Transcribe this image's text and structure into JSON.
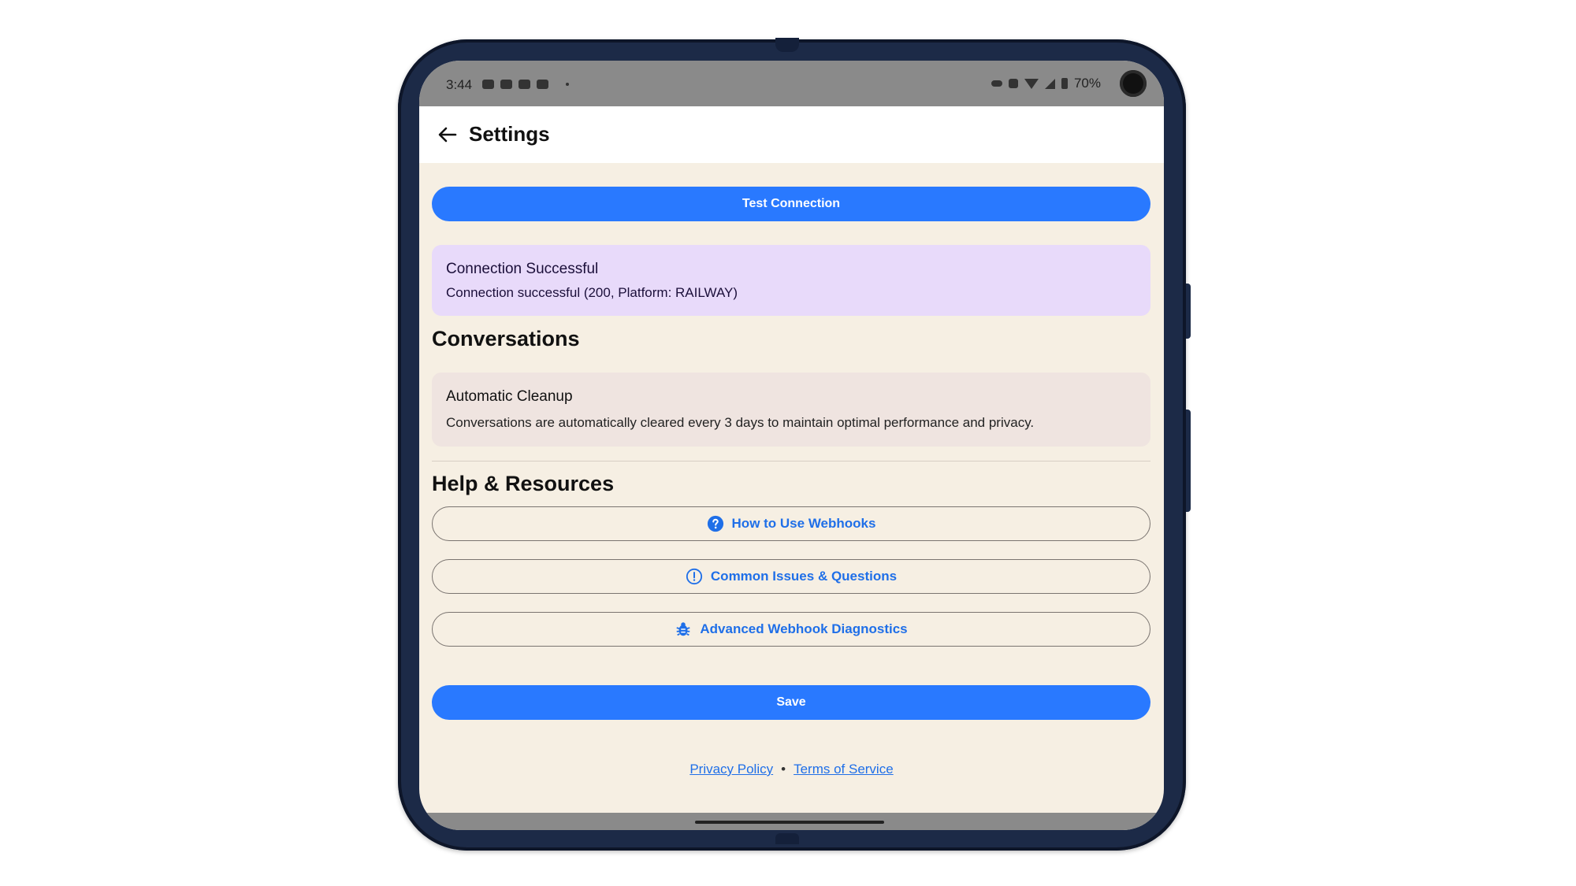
{
  "status_bar": {
    "time": "3:44",
    "battery": "70%",
    "notification_icons": [
      "notification-icon",
      "youtube-icon",
      "youtube-icon",
      "youtube-icon"
    ]
  },
  "app_bar": {
    "title": "Settings",
    "back_icon": "arrow-back-icon"
  },
  "connection": {
    "test_button_label": "Test Connection",
    "result_title": "Connection Successful",
    "result_detail": "Connection successful (200, Platform: RAILWAY)"
  },
  "conversations": {
    "section_title": "Conversations",
    "card_title": "Automatic Cleanup",
    "card_text": "Conversations are automatically cleared every 3 days to maintain optimal performance and privacy."
  },
  "help": {
    "section_title": "Help & Resources",
    "buttons": [
      {
        "label": "How to Use Webhooks",
        "icon": "help-circle-icon"
      },
      {
        "label": "Common Issues & Questions",
        "icon": "info-outline-icon"
      },
      {
        "label": "Advanced Webhook Diagnostics",
        "icon": "bug-icon"
      }
    ]
  },
  "save_button_label": "Save",
  "footer": {
    "privacy_label": "Privacy Policy",
    "separator": "•",
    "terms_label": "Terms of Service"
  },
  "colors": {
    "primary": "#2979ff",
    "background": "#f6efe3",
    "success_card": "#e8dafa",
    "info_card": "#efe4e0"
  }
}
